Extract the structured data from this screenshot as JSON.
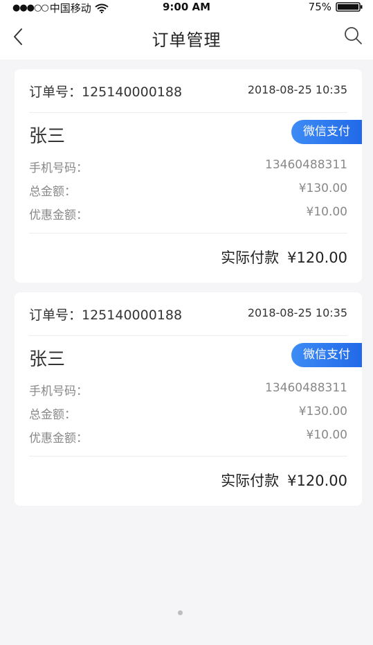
{
  "status_bar": {
    "signal": "●●●○○",
    "carrier": "中国移动",
    "time": "9:00 AM",
    "battery": "75%",
    "icons": [
      "wifi-icon",
      "battery-icon"
    ]
  },
  "nav": {
    "title": "订单管理",
    "icons": [
      "back-icon",
      "search-icon"
    ]
  },
  "orders": [
    {
      "order_no": "订单号：125140000188",
      "date": "2018-08-25 10:35",
      "name": "张三",
      "payment_method": "微信支付",
      "phone_label": "手机号码：",
      "phone": "13460488311",
      "total_label": "总金额：",
      "total": "¥130.00",
      "discount_label": "优惠金额：",
      "discount": "¥10.00",
      "actual_label": "实际付款",
      "actual": "¥120.00"
    },
    {
      "order_no": "订单号：125140000188",
      "date": "2018-08-25 10:35",
      "name": "张三",
      "payment_method": "微信支付",
      "phone_label": "手机号码：",
      "phone": "13460488311",
      "total_label": "总金额：",
      "total": "¥130.00",
      "discount_label": "优惠金额：",
      "discount": "¥10.00",
      "actual_label": "实际付款",
      "actual": "¥120.00"
    }
  ],
  "colors": {
    "accent": "#2a75ee",
    "background": "#f5f5f7",
    "card": "#ffffff",
    "muted_text": "#888888"
  }
}
